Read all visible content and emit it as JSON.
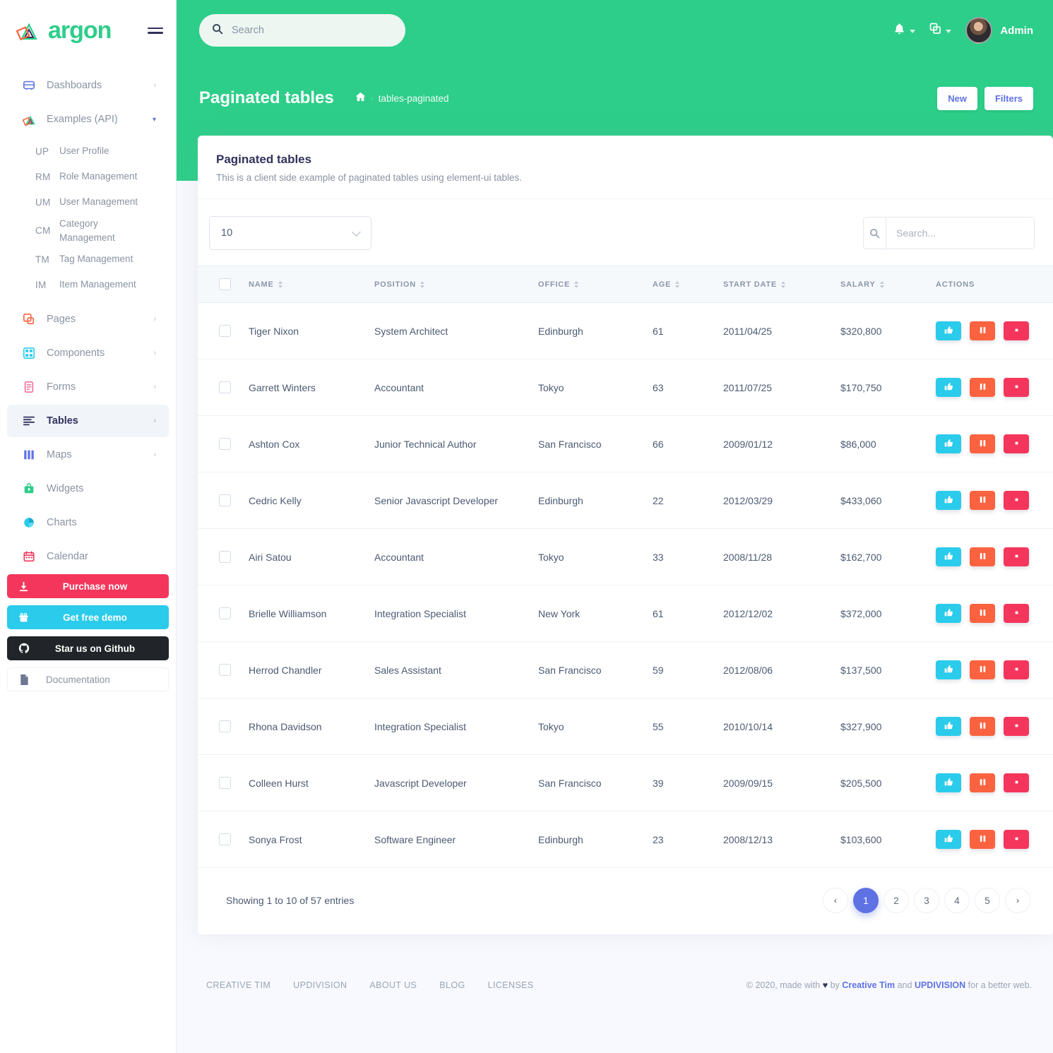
{
  "brand": {
    "name": "argon",
    "logo_icon": "argon-logo-icon",
    "menu_icon": "hamburger-icon"
  },
  "colors": {
    "brand_green": "#2dce89",
    "accent_indigo": "#5e72e4",
    "danger": "#f5365c",
    "warning": "#fb6340",
    "info": "#2bcbeb",
    "dark": "#212529",
    "page_bg": "#f8f9fe"
  },
  "sidebar": {
    "items": [
      {
        "label": "Dashboards",
        "icon": "dashboard-icon",
        "caret": "chevron-right-icon",
        "active": false
      },
      {
        "label": "Examples (API)",
        "icon": "argon-mark-icon",
        "caret": "chevron-down-icon",
        "active": false
      },
      {
        "label": "Pages",
        "icon": "pages-icon",
        "caret": "chevron-right-icon",
        "active": false
      },
      {
        "label": "Components",
        "icon": "components-icon",
        "caret": "chevron-right-icon",
        "active": false
      },
      {
        "label": "Forms",
        "icon": "forms-icon",
        "caret": "chevron-right-icon",
        "active": false
      },
      {
        "label": "Tables",
        "icon": "tables-icon",
        "caret": "chevron-right-icon",
        "active": true
      },
      {
        "label": "Maps",
        "icon": "maps-icon",
        "caret": "chevron-right-icon",
        "active": false
      },
      {
        "label": "Widgets",
        "icon": "widgets-icon",
        "caret": "",
        "active": false
      },
      {
        "label": "Charts",
        "icon": "charts-icon",
        "caret": "",
        "active": false
      },
      {
        "label": "Calendar",
        "icon": "calendar-icon",
        "caret": "",
        "active": false
      }
    ],
    "examples_subitems": [
      {
        "abbr": "UP",
        "label": "User Profile"
      },
      {
        "abbr": "RM",
        "label": "Role Management"
      },
      {
        "abbr": "UM",
        "label": "User Management"
      },
      {
        "abbr": "CM",
        "label": "Category Management"
      },
      {
        "abbr": "TM",
        "label": "Tag Management"
      },
      {
        "abbr": "IM",
        "label": "Item Management"
      }
    ],
    "promos": [
      {
        "label": "Purchase now",
        "icon": "download-icon",
        "style": "purchase"
      },
      {
        "label": "Get free demo",
        "icon": "gift-icon",
        "style": "demo"
      },
      {
        "label": "Star us on Github",
        "icon": "github-icon",
        "style": "github"
      },
      {
        "label": "Documentation",
        "icon": "document-icon",
        "style": "docs"
      }
    ]
  },
  "topbar": {
    "search": {
      "value": "",
      "placeholder": "Search",
      "icon": "search-icon"
    },
    "notifications_icon": "bell-icon",
    "apps_icon": "copy-icon",
    "user": {
      "name": "Admin",
      "avatar": "user-avatar"
    }
  },
  "page_header": {
    "title": "Paginated tables",
    "breadcrumb_home_icon": "home-icon",
    "breadcrumb_sep": "·",
    "breadcrumb_current": "tables-paginated",
    "buttons": [
      {
        "label": "New"
      },
      {
        "label": "Filters"
      }
    ]
  },
  "card": {
    "title": "Paginated tables",
    "subtitle": "This is a client side example of paginated tables using element-ui tables.",
    "per_page": {
      "value": "10",
      "icon": "chevron-down-icon"
    },
    "table_search": {
      "value": "",
      "placeholder": "Search...",
      "icon": "search-icon"
    }
  },
  "table": {
    "columns": [
      {
        "label": "",
        "sortable": false,
        "key": "checkbox"
      },
      {
        "label": "NAME",
        "sortable": true,
        "key": "name"
      },
      {
        "label": "POSITION",
        "sortable": true,
        "key": "position"
      },
      {
        "label": "OFFICE",
        "sortable": true,
        "key": "office"
      },
      {
        "label": "AGE",
        "sortable": true,
        "key": "age"
      },
      {
        "label": "START DATE",
        "sortable": true,
        "key": "start_date"
      },
      {
        "label": "SALARY",
        "sortable": true,
        "key": "salary"
      },
      {
        "label": "ACTIONS",
        "sortable": false,
        "key": "actions"
      }
    ],
    "rows": [
      {
        "name": "Tiger Nixon",
        "position": "System Architect",
        "office": "Edinburgh",
        "age": "61",
        "start_date": "2011/04/25",
        "salary": "$320,800"
      },
      {
        "name": "Garrett Winters",
        "position": "Accountant",
        "office": "Tokyo",
        "age": "63",
        "start_date": "2011/07/25",
        "salary": "$170,750"
      },
      {
        "name": "Ashton Cox",
        "position": "Junior Technical Author",
        "office": "San Francisco",
        "age": "66",
        "start_date": "2009/01/12",
        "salary": "$86,000"
      },
      {
        "name": "Cedric Kelly",
        "position": "Senior Javascript Developer",
        "office": "Edinburgh",
        "age": "22",
        "start_date": "2012/03/29",
        "salary": "$433,060"
      },
      {
        "name": "Airi Satou",
        "position": "Accountant",
        "office": "Tokyo",
        "age": "33",
        "start_date": "2008/11/28",
        "salary": "$162,700"
      },
      {
        "name": "Brielle Williamson",
        "position": "Integration Specialist",
        "office": "New York",
        "age": "61",
        "start_date": "2012/12/02",
        "salary": "$372,000"
      },
      {
        "name": "Herrod Chandler",
        "position": "Sales Assistant",
        "office": "San Francisco",
        "age": "59",
        "start_date": "2012/08/06",
        "salary": "$137,500"
      },
      {
        "name": "Rhona Davidson",
        "position": "Integration Specialist",
        "office": "Tokyo",
        "age": "55",
        "start_date": "2010/10/14",
        "salary": "$327,900"
      },
      {
        "name": "Colleen Hurst",
        "position": "Javascript Developer",
        "office": "San Francisco",
        "age": "39",
        "start_date": "2009/09/15",
        "salary": "$205,500"
      },
      {
        "name": "Sonya Frost",
        "position": "Software Engineer",
        "office": "Edinburgh",
        "age": "23",
        "start_date": "2008/12/13",
        "salary": "$103,600"
      }
    ],
    "row_actions": [
      {
        "name": "like-button",
        "icon": "thumbs-up-icon",
        "color": "#2bcbeb"
      },
      {
        "name": "edit-button",
        "icon": "edit-icon",
        "color": "#fb6340"
      },
      {
        "name": "delete-button",
        "icon": "trash-icon",
        "color": "#f5365c"
      }
    ]
  },
  "pagination": {
    "showing": "Showing 1 to 10 of 57 entries",
    "prev_icon": "chevron-left-icon",
    "next_icon": "chevron-right-icon",
    "pages": [
      "1",
      "2",
      "3",
      "4",
      "5"
    ],
    "active_page": "1"
  },
  "footer": {
    "links": [
      "CREATIVE TIM",
      "UPDIVISION",
      "ABOUT US",
      "BLOG",
      "LICENSES"
    ],
    "copyright_pre": "© 2020, made with",
    "heart_icon": "heart-icon",
    "copyright_by": "by",
    "brand1": "Creative Tim",
    "copyright_and": "and",
    "brand2": "UPDIVISION",
    "copyright_post": "for a better web."
  }
}
